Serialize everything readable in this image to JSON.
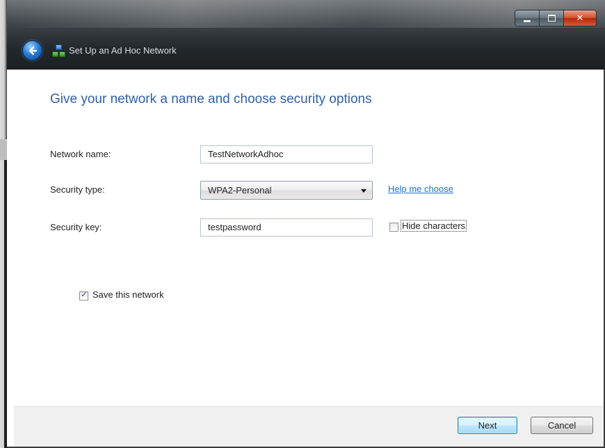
{
  "window": {
    "title": "Set Up an Ad Hoc Network"
  },
  "page": {
    "heading": "Give your network a name and choose security options"
  },
  "form": {
    "network_name_label": "Network name:",
    "network_name_value": "TestNetworkAdhoc",
    "security_type_label": "Security type:",
    "security_type_value": "WPA2-Personal",
    "help_link": "Help me choose",
    "security_key_label": "Security key:",
    "security_key_value": "testpassword",
    "hide_characters_label": "Hide characters",
    "hide_characters_checked": false,
    "save_network_label": "Save this network",
    "save_network_checked": true
  },
  "footer": {
    "next_label": "Next",
    "cancel_label": "Cancel"
  },
  "colors": {
    "heading": "#2f5fa8",
    "link": "#1c6fd6",
    "close_button": "#c8401e"
  }
}
